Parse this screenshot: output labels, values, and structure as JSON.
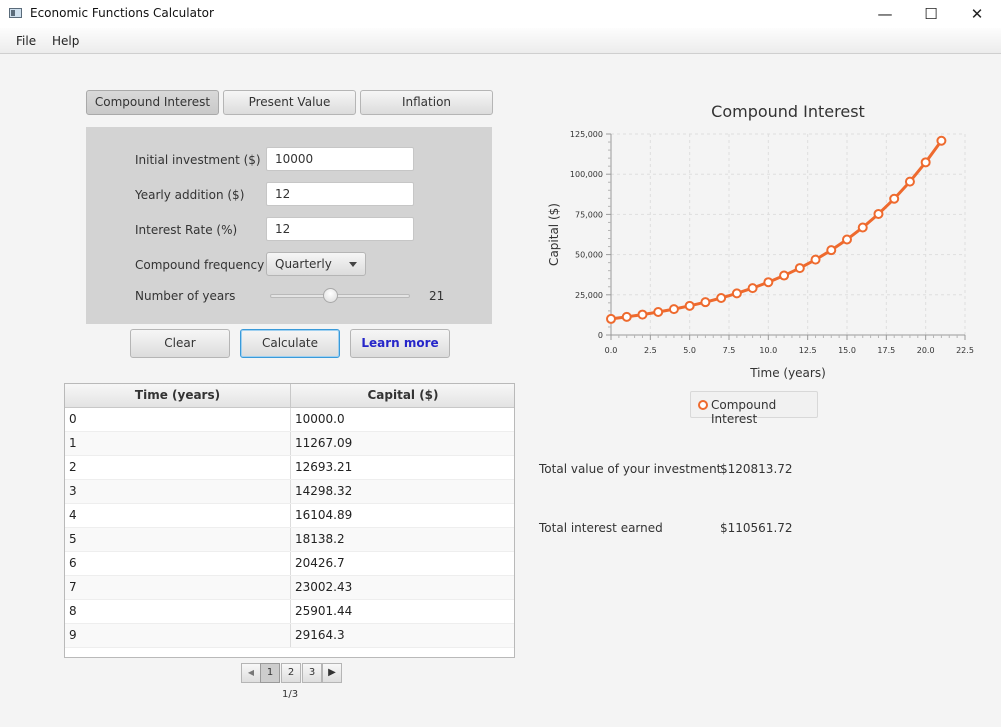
{
  "window": {
    "title": "Economic Functions Calculator",
    "minimize": "—",
    "maximize": "☐",
    "close": "✕"
  },
  "menu": {
    "file": "File",
    "help": "Help"
  },
  "tabs": [
    "Compound Interest",
    "Present Value",
    "Inflation"
  ],
  "form": {
    "initial_label": "Initial investment ($)",
    "initial_value": "10000",
    "yearly_label": "Yearly addition ($)",
    "yearly_value": "12",
    "rate_label": "Interest Rate (%)",
    "rate_value": "12",
    "freq_label": "Compound frequency",
    "freq_value": "Quarterly",
    "years_label": "Number of years",
    "years_value": "21",
    "years_slider_fraction": 0.42
  },
  "buttons": {
    "clear": "Clear",
    "calculate": "Calculate",
    "learn": "Learn more"
  },
  "table": {
    "headers": [
      "Time (years)",
      "Capital ($)"
    ],
    "rows": [
      [
        "0",
        "10000.0"
      ],
      [
        "1",
        "11267.09"
      ],
      [
        "2",
        "12693.21"
      ],
      [
        "3",
        "14298.32"
      ],
      [
        "4",
        "16104.89"
      ],
      [
        "5",
        "18138.2"
      ],
      [
        "6",
        "20426.7"
      ],
      [
        "7",
        "23002.43"
      ],
      [
        "8",
        "25901.44"
      ],
      [
        "9",
        "29164.3"
      ]
    ]
  },
  "pager": {
    "pages": [
      "1",
      "2",
      "3"
    ],
    "active": "1",
    "label": "1/3"
  },
  "results": {
    "total_label": "Total value of your investment",
    "total_value": "$120813.72",
    "interest_label": "Total interest earned",
    "interest_value": "$110561.72"
  },
  "chart_data": {
    "type": "line",
    "title": "Compound Interest",
    "xlabel": "Time (years)",
    "ylabel": "Capital ($)",
    "xlim": [
      0,
      22.5
    ],
    "ylim": [
      0,
      125000
    ],
    "xticks": [
      "0.0",
      "2.5",
      "5.0",
      "7.5",
      "10.0",
      "12.5",
      "15.0",
      "17.5",
      "20.0",
      "22.5"
    ],
    "yticks": [
      "0",
      "25,000",
      "50,000",
      "75,000",
      "100,000",
      "125,000"
    ],
    "grid": true,
    "legend": "bottom",
    "series": [
      {
        "name": "Compound Interest",
        "color": "#ee6a2e",
        "x": [
          0,
          1,
          2,
          3,
          4,
          5,
          6,
          7,
          8,
          9,
          10,
          11,
          12,
          13,
          14,
          15,
          16,
          17,
          18,
          19,
          20,
          21
        ],
        "y": [
          10000,
          11267.09,
          12693.21,
          14298.32,
          16104.89,
          18138.2,
          20426.7,
          23002.43,
          25901.44,
          29164.3,
          32836,
          36970,
          41623,
          46862,
          52758,
          59395,
          66865,
          75274,
          84740,
          95395,
          107390,
          120813.72
        ]
      }
    ]
  }
}
